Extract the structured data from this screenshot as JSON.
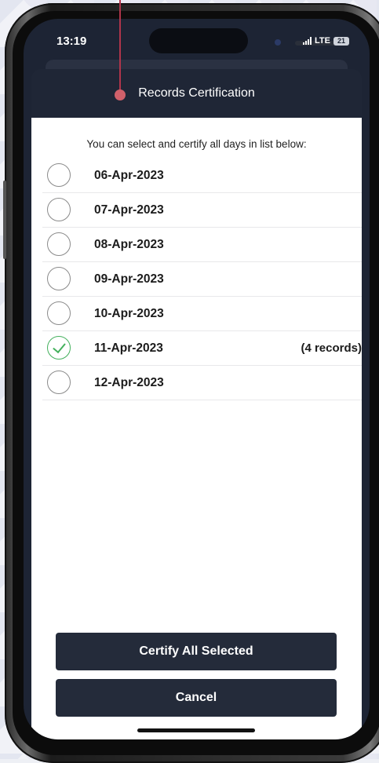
{
  "status": {
    "time": "13:19",
    "network": "LTE",
    "battery": "21"
  },
  "header": {
    "title": "Records Certification"
  },
  "intro": "You can select and certify all days in list below:",
  "days": [
    {
      "date": "06-Apr-2023",
      "checked": false,
      "records": ""
    },
    {
      "date": "07-Apr-2023",
      "checked": false,
      "records": ""
    },
    {
      "date": "08-Apr-2023",
      "checked": false,
      "records": ""
    },
    {
      "date": "09-Apr-2023",
      "checked": false,
      "records": ""
    },
    {
      "date": "10-Apr-2023",
      "checked": false,
      "records": ""
    },
    {
      "date": "11-Apr-2023",
      "checked": true,
      "records": "(4 records)"
    },
    {
      "date": "12-Apr-2023",
      "checked": false,
      "records": ""
    }
  ],
  "buttons": {
    "certify": "Certify All Selected",
    "cancel": "Cancel"
  },
  "colors": {
    "header": "#1f2636",
    "button": "#242b3a",
    "check": "#43b05c",
    "annotation": "#b0354b"
  }
}
